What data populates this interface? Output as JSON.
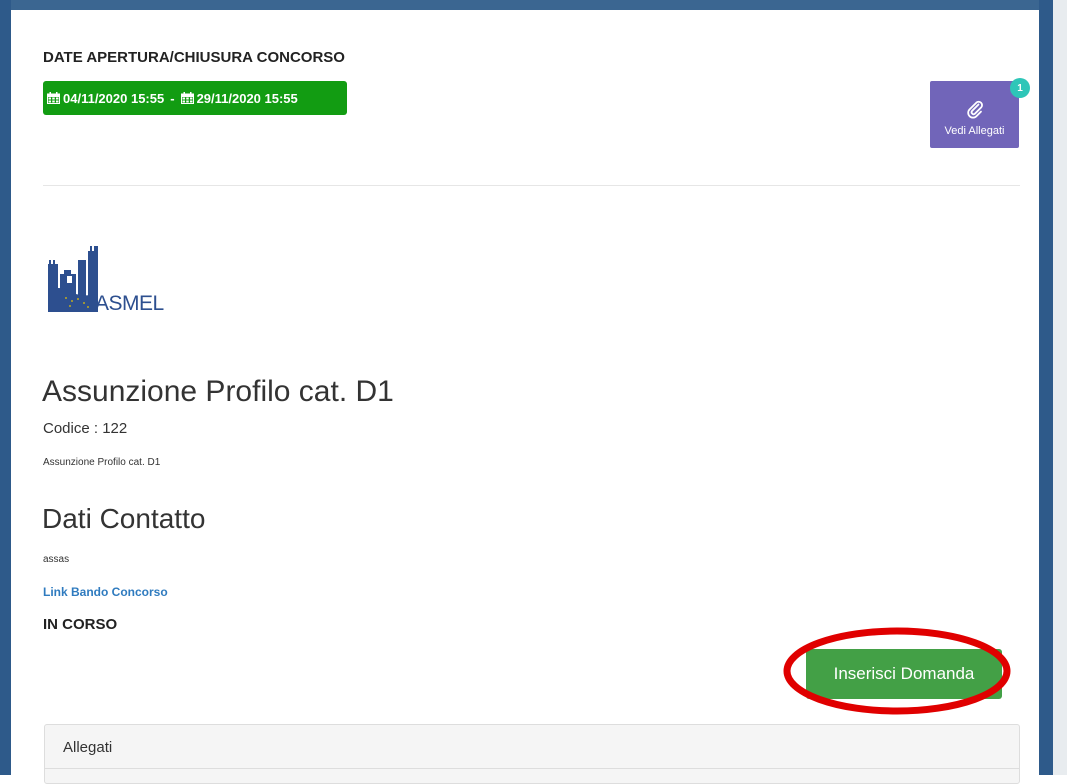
{
  "dates": {
    "title": "DATE APERTURA/CHIUSURA CONCORSO",
    "open": "04/11/2020 15:55",
    "separator": "-",
    "close": "29/11/2020 15:55",
    "badge_color": "#129c12"
  },
  "attachments_button": {
    "label": "Vedi Allegati",
    "count": "1",
    "icon": "paperclip-icon",
    "color": "#7165b9"
  },
  "logo": {
    "text": "ASMEL"
  },
  "competition": {
    "title": "Assunzione Profilo cat. D1",
    "code_line": "Codice : 122",
    "description": "Assunzione Profilo cat. D1"
  },
  "contact": {
    "title": "Dati Contatto",
    "text": "assas"
  },
  "link_label": "Link Bando Concorso",
  "status": "IN CORSO",
  "insert_button": {
    "label": "Inserisci Domanda",
    "color": "#43a046"
  },
  "attachments_panel": {
    "heading": "Allegati"
  },
  "colors": {
    "frame": "#2e5a8a",
    "highlight": "#e00000"
  }
}
